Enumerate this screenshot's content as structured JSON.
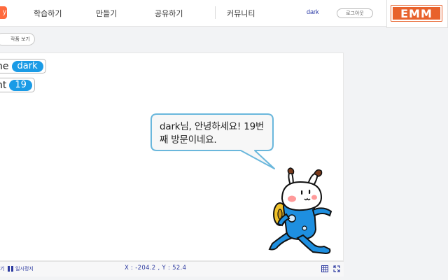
{
  "header": {
    "logo_text": "y",
    "nav": [
      "학습하기",
      "만들기",
      "공유하기",
      "커뮤니티"
    ],
    "username": "dark",
    "logout_label": "로그아웃"
  },
  "extension_badge": {
    "text": "EMM",
    "color": "#e8622c"
  },
  "toolbar": {
    "view_work_label": "작품 보기"
  },
  "stage": {
    "variables": [
      {
        "name": "ne",
        "value": "dark"
      },
      {
        "name": "nt",
        "value": "19"
      }
    ],
    "speech_bubble": "dark님, 안녕하세요! 19번째 방문이네요.",
    "sprite": "entry-bot-mascot"
  },
  "controls": {
    "stop_label": "기",
    "pause_label": "일시정지",
    "coordinates": "X : -204.2 , Y : 52.4"
  },
  "icons": {
    "grid": "grid-icon",
    "fullscreen": "fullscreen-icon",
    "pause": "pause-icon"
  },
  "colors": {
    "accent": "#1a9be6",
    "logo": "#ff6a3d",
    "coordinate_text": "#2d3aa0",
    "bubble_border": "#6ab7dc"
  }
}
